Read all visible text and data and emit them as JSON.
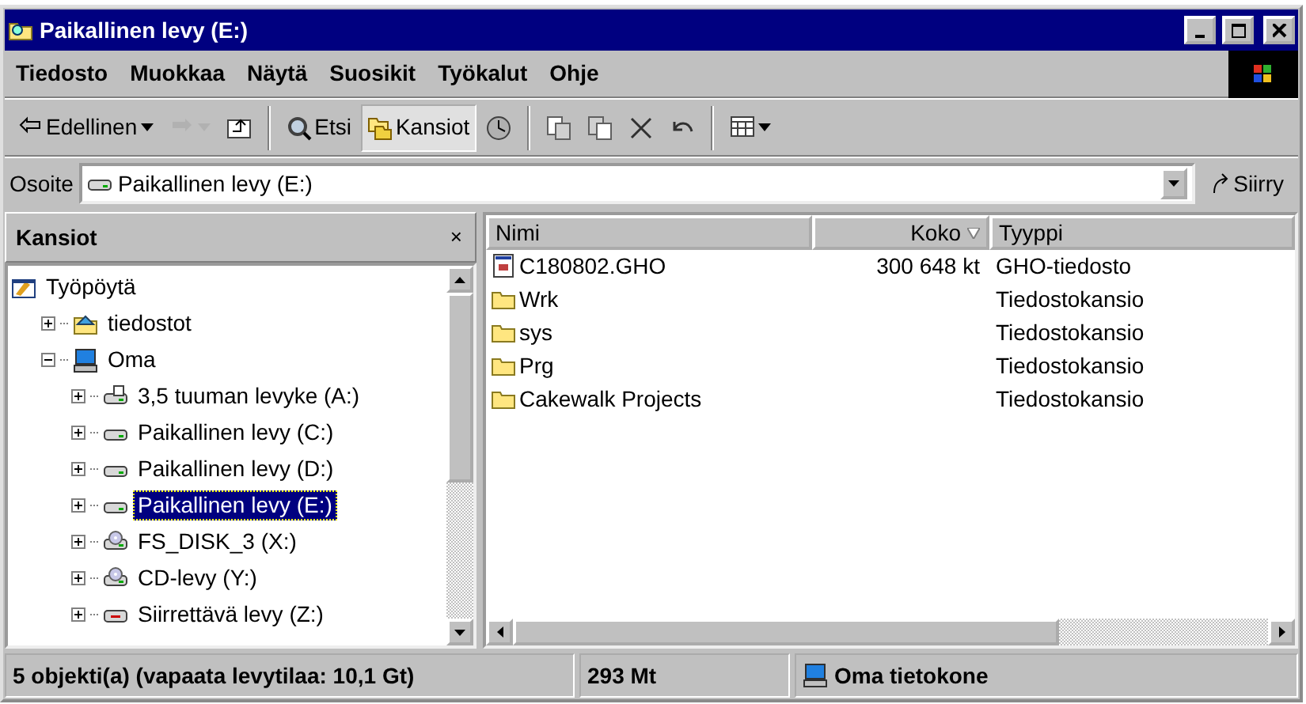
{
  "window": {
    "title": "Paikallinen levy (E:)"
  },
  "menu": [
    {
      "label": "Tiedosto"
    },
    {
      "label": "Muokkaa"
    },
    {
      "label": "Näytä"
    },
    {
      "label": "Suosikit"
    },
    {
      "label": "Työkalut"
    },
    {
      "label": "Ohje"
    }
  ],
  "toolbar": [
    {
      "kind": "back",
      "label": "Edellinen",
      "dropdown": true,
      "disabled": false,
      "pressed": false
    },
    {
      "kind": "forward",
      "dropdown": true,
      "disabled": true,
      "pressed": false
    },
    {
      "kind": "up",
      "dropdown": false,
      "disabled": false,
      "pressed": false
    },
    {
      "kind": "separator"
    },
    {
      "kind": "search",
      "label": "Etsi",
      "dropdown": false,
      "disabled": false,
      "pressed": false
    },
    {
      "kind": "folders",
      "label": "Kansiot",
      "dropdown": false,
      "disabled": false,
      "pressed": true
    },
    {
      "kind": "history",
      "dropdown": false,
      "disabled": false,
      "pressed": false
    },
    {
      "kind": "separator"
    },
    {
      "kind": "move",
      "dropdown": false,
      "disabled": false,
      "pressed": false
    },
    {
      "kind": "copy",
      "dropdown": false,
      "disabled": false,
      "pressed": false
    },
    {
      "kind": "delete",
      "dropdown": false,
      "disabled": false,
      "pressed": false
    },
    {
      "kind": "undo",
      "dropdown": false,
      "disabled": false,
      "pressed": false
    },
    {
      "kind": "separator"
    },
    {
      "kind": "views",
      "dropdown": true,
      "disabled": false,
      "pressed": false
    }
  ],
  "address": {
    "label": "Osoite",
    "value": "Paikallinen levy (E:)",
    "go": "Siirry"
  },
  "folders_pane": {
    "title": "Kansiot",
    "close": "×",
    "tree": [
      {
        "label": "Työpöytä",
        "kind": "desktop",
        "selected": false,
        "children": [
          {
            "label": "tiedostot",
            "kind": "shared",
            "expanded": false,
            "selected": false
          },
          {
            "label": "Oma",
            "kind": "computer",
            "expanded": true,
            "selected": false,
            "children": [
              {
                "label": "3,5 tuuman levyke (A:)",
                "kind": "floppy",
                "expanded": false,
                "selected": false
              },
              {
                "label": "Paikallinen levy (C:)",
                "kind": "drive",
                "expanded": false,
                "selected": false
              },
              {
                "label": "Paikallinen levy (D:)",
                "kind": "drive",
                "expanded": false,
                "selected": false
              },
              {
                "label": "Paikallinen levy (E:)",
                "kind": "drive",
                "expanded": false,
                "selected": true
              },
              {
                "label": "FS_DISK_3 (X:)",
                "kind": "cdrom",
                "expanded": false,
                "selected": false
              },
              {
                "label": "CD-levy (Y:)",
                "kind": "cdrom",
                "expanded": false,
                "selected": false
              },
              {
                "label": "Siirrettävä levy (Z:)",
                "kind": "removable",
                "expanded": false,
                "selected": false
              }
            ]
          }
        ]
      }
    ]
  },
  "file_list": {
    "columns": [
      {
        "label": "Nimi",
        "sorted": false
      },
      {
        "label": "Koko",
        "sorted": true
      },
      {
        "label": "Tyyppi",
        "sorted": false
      }
    ],
    "rows": [
      {
        "kind": "file",
        "name": "C180802.GHO",
        "size": "300 648 kt",
        "type": "GHO-tiedosto"
      },
      {
        "kind": "folder",
        "name": "Wrk",
        "type": "Tiedostokansio"
      },
      {
        "kind": "folder",
        "name": "sys",
        "type": "Tiedostokansio"
      },
      {
        "kind": "folder",
        "name": "Prg",
        "type": "Tiedostokansio"
      },
      {
        "kind": "folder",
        "name": "Cakewalk Projects",
        "type": "Tiedostokansio"
      }
    ]
  },
  "status_bar": {
    "objects": "5 objekti(a) (vapaata levytilaa: 10,1 Gt)",
    "size": "293 Mt",
    "zone": "Oma tietokone"
  }
}
